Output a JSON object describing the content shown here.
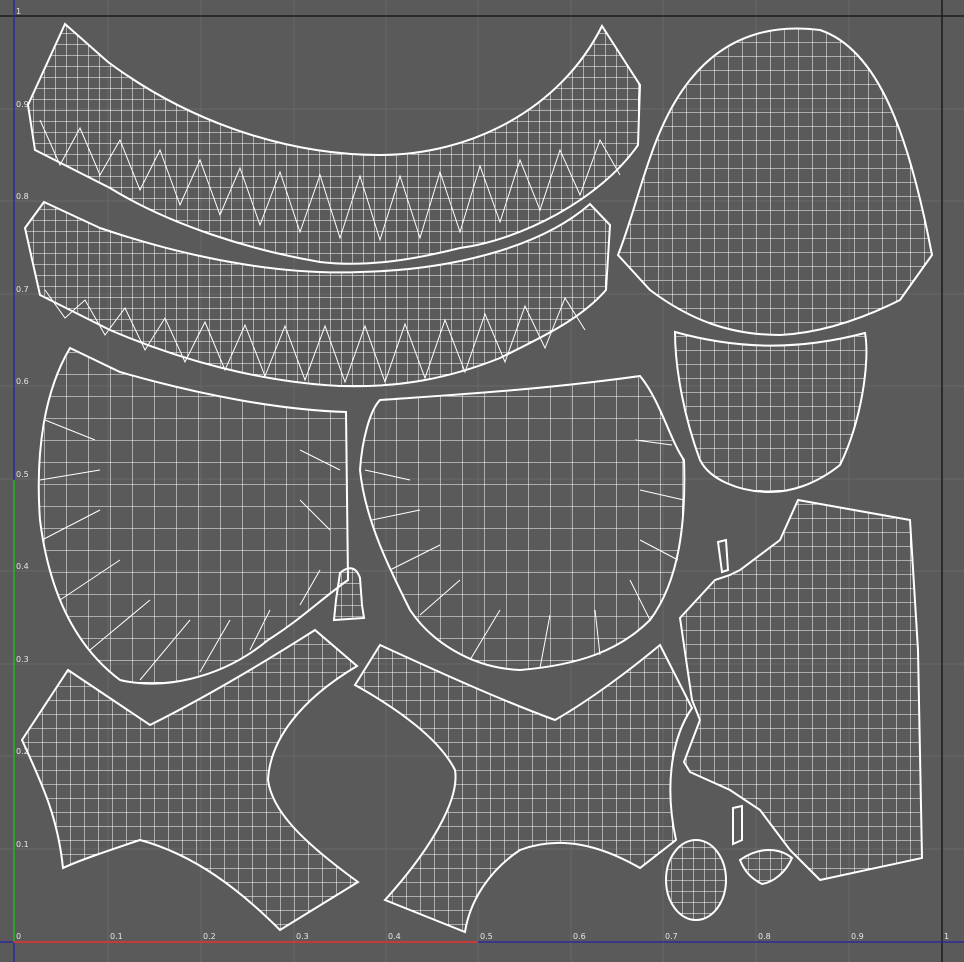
{
  "viewport": {
    "background_color": "#5a5a5a",
    "grid_color": "#6a6a6a",
    "frame_color": "#1c1c1c",
    "u_axis_color": "#c83a3a",
    "v_axis_color": "#2fa02f",
    "uv_edge_color": "#ffffff"
  },
  "u_ticks": [
    "0",
    "0.1",
    "0.2",
    "0.3",
    "0.4",
    "0.5",
    "0.6",
    "0.7",
    "0.8",
    "0.9",
    "1"
  ],
  "v_ticks": [
    "0.1",
    "0.2",
    "0.3",
    "0.4",
    "0.5",
    "0.6",
    "0.7",
    "0.8",
    "0.9",
    "1"
  ],
  "uv_islands": [
    "top-ruffle-strip",
    "second-ruffle-strip",
    "left-apron-panel",
    "right-apron-panel",
    "small-tab",
    "cap-dome",
    "cap-band",
    "bodice-side-panel",
    "left-sleeve-piece",
    "right-sleeve-piece",
    "oval-patch",
    "small-lens-patch",
    "thin-strap-top",
    "thin-strap-bottom"
  ]
}
